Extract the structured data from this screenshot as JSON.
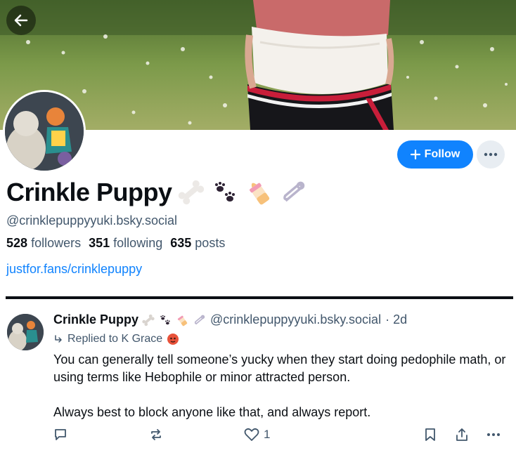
{
  "header": {
    "back_icon": "arrow-left-icon"
  },
  "profile": {
    "display_name": "Crinkle Puppy",
    "name_emojis": [
      "bone-icon",
      "paw-prints-icon",
      "baby-bottle-icon",
      "safety-pin-icon"
    ],
    "handle": "@crinklepuppyyuki.bsky.social",
    "followers_count": "528",
    "followers_label": "followers",
    "following_count": "351",
    "following_label": "following",
    "posts_count": "635",
    "posts_label": "posts",
    "website": "justfor.fans/crinklepuppy",
    "follow_label": "Follow",
    "accent_color": "#1083fe"
  },
  "post": {
    "author_name": "Crinkle Puppy",
    "author_handle": "@crinklepuppyyuki.bsky.social",
    "time": "· 2d",
    "replied_to": "Replied to K Grace",
    "paragraph_1": "You can generally tell someone’s yucky when they start doing pedophile math, or using terms like Hebophile or minor attracted person.",
    "paragraph_2": "Always best to block anyone like that, and always report.",
    "like_count": "1"
  }
}
